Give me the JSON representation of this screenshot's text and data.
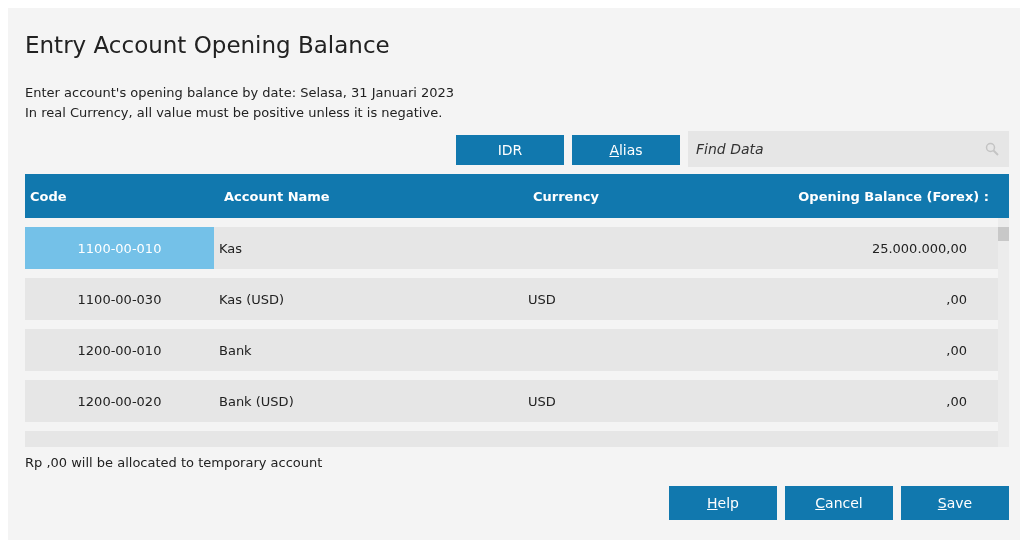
{
  "title": "Entry Account Opening Balance",
  "info_lines": [
    "Enter account's opening balance by date: Selasa, 31 Januari 2023",
    "In real Currency, all value must be positive unless it is negative."
  ],
  "toolbar_buttons": [
    {
      "label": "IDR",
      "mnemonic": false
    },
    {
      "label": "Alias",
      "mnemonic": true
    }
  ],
  "search": {
    "placeholder": "Find Data"
  },
  "table": {
    "columns": [
      "Code",
      "Account Name",
      "Currency",
      "Opening Balance (Forex) :"
    ],
    "rows": [
      {
        "code": "1100-00-010",
        "name": "Kas",
        "currency": "",
        "balance": "25.000.000,00",
        "selected": true
      },
      {
        "code": "1100-00-030",
        "name": "Kas (USD)",
        "currency": "USD",
        "balance": ",00",
        "selected": false
      },
      {
        "code": "1200-00-010",
        "name": "Bank",
        "currency": "",
        "balance": ",00",
        "selected": false
      },
      {
        "code": "1200-00-020",
        "name": "Bank (USD)",
        "currency": "USD",
        "balance": ",00",
        "selected": false
      }
    ]
  },
  "footer_note": "Rp ,00 will be allocated to temporary account",
  "buttons": [
    {
      "label": "Help",
      "mnemonic": true
    },
    {
      "label": "Cancel",
      "mnemonic": true
    },
    {
      "label": "Save",
      "mnemonic": true
    }
  ]
}
